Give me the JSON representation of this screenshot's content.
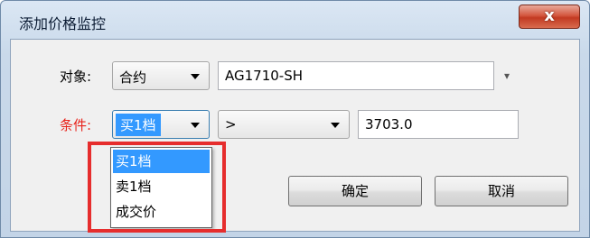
{
  "window": {
    "title": "添加价格监控",
    "close_label": "x"
  },
  "form": {
    "object_label": "对象:",
    "object_type": "合约",
    "contract_code": "AG1710-SH",
    "condition_label": "条件:",
    "condition_field": "买1档",
    "operator": ">",
    "price_value": "3703.0",
    "code_dropdown_glyph": "▾"
  },
  "dropdown": {
    "options": [
      {
        "label": "买1档",
        "selected": true
      },
      {
        "label": "卖1档",
        "selected": false
      },
      {
        "label": "成交价",
        "selected": false
      }
    ]
  },
  "buttons": {
    "ok_label": "确定",
    "cancel_label": "取消"
  },
  "colors": {
    "condition_label": "#e8231b",
    "highlight_box": "#e62d2d",
    "selection": "#3399ff"
  }
}
